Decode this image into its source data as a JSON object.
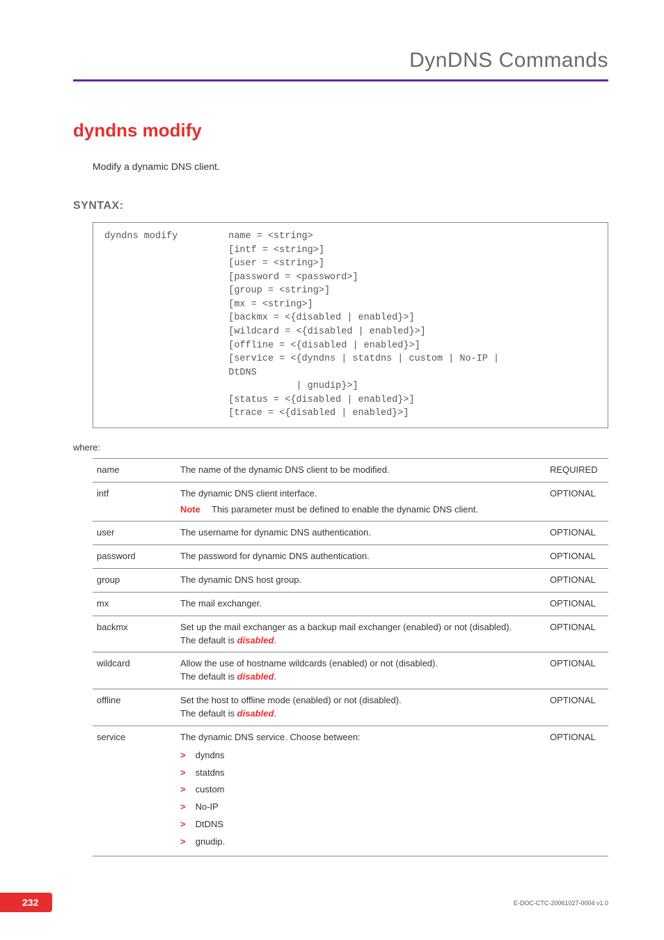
{
  "header": {
    "title": "DynDNS Commands"
  },
  "command": {
    "title": "dyndns modify",
    "description": "Modify a dynamic DNS client."
  },
  "syntax": {
    "heading": "SYNTAX:",
    "code": "dyndns modify         name = <string>\n                      [intf = <string>]\n                      [user = <string>]\n                      [password = <password>]\n                      [group = <string>]\n                      [mx = <string>]\n                      [backmx = <{disabled | enabled}>]\n                      [wildcard = <{disabled | enabled}>]\n                      [offline = <{disabled | enabled}>]\n                      [service = <{dyndns | statdns | custom | No-IP |\n                      DtDNS\n                                  | gnudip}>]\n                      [status = <{disabled | enabled}>]\n                      [trace = <{disabled | enabled}>]"
  },
  "where": "where:",
  "noteLabel": "Note",
  "defaultWord": "disabled",
  "params": [
    {
      "name": "name",
      "desc": "The name of the dynamic DNS client to be modified.",
      "req": "REQUIRED"
    },
    {
      "name": "intf",
      "desc": "The dynamic DNS client interface.",
      "noteText": "This parameter must be defined to enable the dynamic DNS client.",
      "req": "OPTIONAL"
    },
    {
      "name": "user",
      "desc": "The username for dynamic DNS authentication.",
      "req": "OPTIONAL"
    },
    {
      "name": "password",
      "desc": "The password for dynamic DNS authentication.",
      "req": "OPTIONAL"
    },
    {
      "name": "group",
      "desc": "The dynamic DNS host group.",
      "req": "OPTIONAL"
    },
    {
      "name": "mx",
      "desc": "The mail exchanger.",
      "req": "OPTIONAL"
    },
    {
      "name": "backmx",
      "desc": "Set up the mail exchanger as a backup mail exchanger (enabled) or not (disabled).",
      "hasDefault": true,
      "req": "OPTIONAL"
    },
    {
      "name": "wildcard",
      "desc": "Allow the use of hostname wildcards (enabled) or not (disabled).",
      "hasDefault": true,
      "req": "OPTIONAL"
    },
    {
      "name": "offline",
      "desc": "Set the host to offline mode (enabled) or not (disabled).",
      "hasDefault": true,
      "req": "OPTIONAL"
    },
    {
      "name": "service",
      "desc": "The dynamic DNS service. Choose between:",
      "options": [
        "dyndns",
        "statdns",
        "custom",
        "No-IP",
        "DtDNS",
        "gnudip."
      ],
      "req": "OPTIONAL"
    }
  ],
  "defaultPrefix": "The default is ",
  "footer": {
    "pageNumber": "232",
    "docId": "E-DOC-CTC-20061027-0004 v1.0"
  }
}
